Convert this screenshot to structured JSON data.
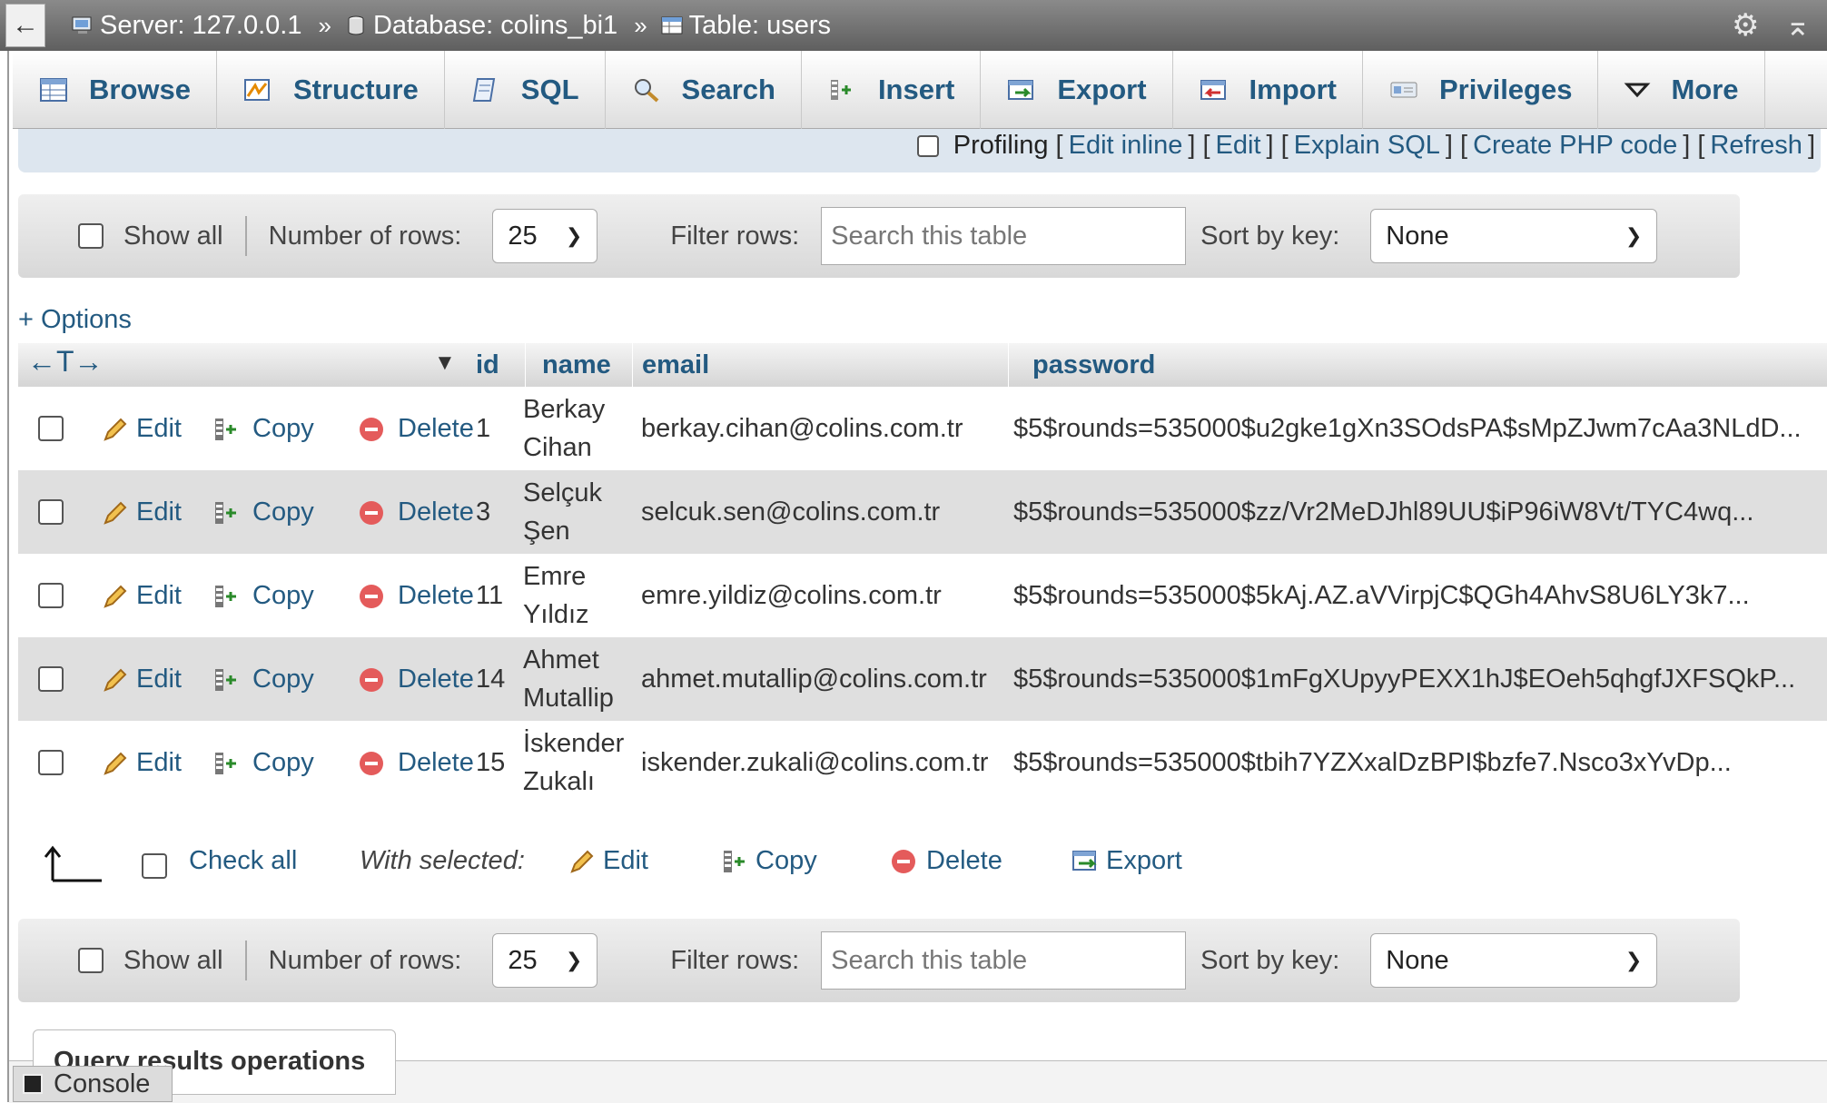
{
  "breadcrumb": {
    "server": "Server: 127.0.0.1",
    "database": "Database: colins_bi1",
    "table": "Table: users",
    "separator": "»"
  },
  "tabs": [
    {
      "label": "Browse",
      "icon": "browse-icon"
    },
    {
      "label": "Structure",
      "icon": "structure-icon"
    },
    {
      "label": "SQL",
      "icon": "sql-icon"
    },
    {
      "label": "Search",
      "icon": "search-icon"
    },
    {
      "label": "Insert",
      "icon": "insert-icon"
    },
    {
      "label": "Export",
      "icon": "export-icon"
    },
    {
      "label": "Import",
      "icon": "import-icon"
    },
    {
      "label": "Privileges",
      "icon": "privileges-icon"
    },
    {
      "label": "More",
      "icon": "caret-down-icon"
    }
  ],
  "profiling": {
    "label": "Profiling",
    "links": [
      "Edit inline",
      "Edit",
      "Explain SQL",
      "Create PHP code",
      "Refresh"
    ]
  },
  "nav": {
    "show_all": "Show all",
    "rows_label": "Number of rows:",
    "rows_value": "25",
    "filter_label": "Filter rows:",
    "filter_placeholder": "Search this table",
    "sort_label": "Sort by key:",
    "sort_value": "None"
  },
  "options_link": "+ Options",
  "table": {
    "columns": [
      "id",
      "name",
      "email",
      "password"
    ],
    "actions": {
      "edit": "Edit",
      "copy": "Copy",
      "delete": "Delete"
    },
    "rows": [
      {
        "id": "1",
        "name1": "Berkay",
        "name2": "Cihan",
        "email": "berkay.cihan@colins.com.tr",
        "password": "$5$rounds=535000$u2gke1gXn3SOdsPA$sMpZJwm7cAa3NLdD..."
      },
      {
        "id": "3",
        "name1": "Selçuk",
        "name2": "Şen",
        "email": "selcuk.sen@colins.com.tr",
        "password": "$5$rounds=535000$zz/Vr2MeDJhl89UU$iP96iW8Vt/TYC4wq..."
      },
      {
        "id": "11",
        "name1": "Emre",
        "name2": "Yıldız",
        "email": "emre.yildiz@colins.com.tr",
        "password": "$5$rounds=535000$5kAj.AZ.aVVirpjC$QGh4AhvS8U6LY3k7..."
      },
      {
        "id": "14",
        "name1": "Ahmet",
        "name2": "Mutallip",
        "email": "ahmet.mutallip@colins.com.tr",
        "password": "$5$rounds=535000$1mFgXUpyyPEXX1hJ$EOeh5qhgfJXFSQkP..."
      },
      {
        "id": "15",
        "name1": "İskender",
        "name2": "Zukalı",
        "email": "iskender.zukali@colins.com.tr",
        "password": "$5$rounds=535000$tbih7YZXxalDzBPI$bzfe7.Nsco3xYvDp..."
      }
    ]
  },
  "bulk": {
    "check_all": "Check all",
    "with_selected": "With selected:",
    "edit": "Edit",
    "copy": "Copy",
    "delete": "Delete",
    "export": "Export"
  },
  "query_results": "Query results operations",
  "console": "Console"
}
